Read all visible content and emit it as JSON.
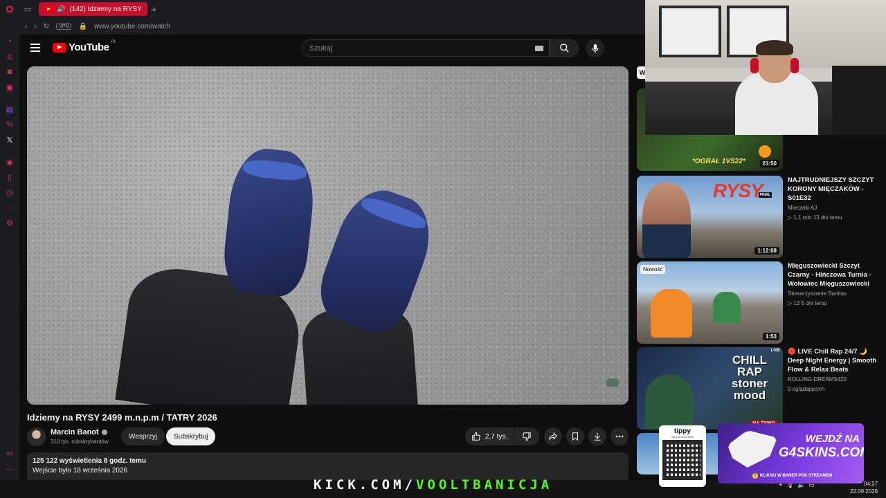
{
  "browser": {
    "tab_title": "(142) Idziemy na RYSY",
    "new_tab": "+",
    "url": "www.youtube.com/watch",
    "vpn_label": "VPN",
    "accent": "#c4102a"
  },
  "youtube": {
    "logo_text": "YouTube",
    "logo_region": "PL",
    "search_placeholder": "Szukaj",
    "video": {
      "title": "Idziemy na RYSY 2499 m.n.p.m / TATRY 2026",
      "channel": "Marcin Banot",
      "subscribers": "310 tys. subskrybentów",
      "support_label": "Wesprzyj",
      "subscribe_label": "Subskrybuj",
      "likes": "2,7 tys.",
      "views_time": "125 122 wyświetlenia  8 godz. temu",
      "description": "Wejście było 18 września 2026"
    },
    "recommendations": [
      {
        "duration": "23:50",
        "overlay_text": "*OGRAŁ 1VS22*"
      },
      {
        "title": "NAJTRUDNIEJSZY SZCZYT KORONY MIĘCZAKÓW - S01E32",
        "channel": "Mieczaki AJ",
        "meta": "▷ 1,1 mln   13 dni temu",
        "duration": "1:12:08",
        "thumb_text": "RYSY",
        "thumb_badge": "FINAŁ"
      },
      {
        "title": "Mięguszowiecki Szczyt Czarny - Hińczowa Turnia - Wołowiec Mięguszowiecki",
        "channel": "Stowarzyszenie Sanitas",
        "meta": "▷ 12   5 dni temu",
        "duration": "1:53",
        "badge": "Nowość"
      },
      {
        "title": "🔴 LIVE Chill Rap 24/7 🌙 Deep Night Energy | Smooth Flow & Relax Beats",
        "channel": "ROLLING DREAMS420",
        "meta": "9 oglądających",
        "thumb_text": "CHILL RAP stoner mood",
        "live_badge": "LIVE",
        "na_zywo": "NA ŻYWO"
      }
    ]
  },
  "overlay": {
    "kick_white1": "KICK.",
    "kick_white2": "COM/",
    "kick_green": "VOOLTBANICJA",
    "tippy_brand": "tippy",
    "tippy_tiny": "tippy.pl/voolt/ tipnij",
    "g4_line1": "WEJDŹ NA",
    "g4_line2": "G4SKINS.COM",
    "g4_line3": "KLIKNIJ W BANER POD STREAMEM",
    "time": "04:27",
    "date": "22.09.2026"
  }
}
